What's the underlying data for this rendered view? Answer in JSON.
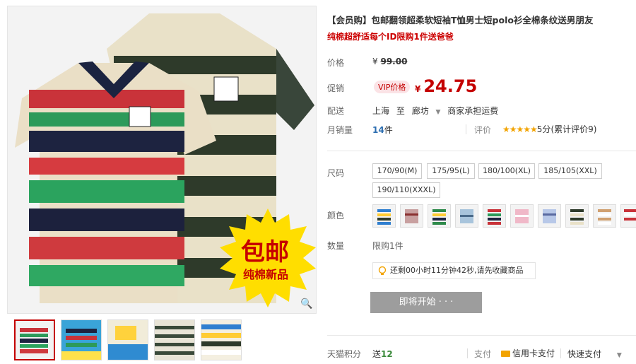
{
  "product": {
    "title": "【会员购】包邮翻领超柔软短袖T恤男士短polo衫全棉条纹送男朋友",
    "subtitle": "纯棉超舒适每个ID限购1件送爸爸"
  },
  "badge": {
    "line1": "包邮",
    "line2": "纯棉新品"
  },
  "price": {
    "label": "价格",
    "currency": "¥",
    "original": "99.00",
    "promo_label": "促销",
    "vip_tag": "VIP价格",
    "promo_price": "24.75"
  },
  "shipping": {
    "label": "配送",
    "from": "上海",
    "to_word": "至",
    "destination": "廊坊",
    "fee_note": "商家承担运费"
  },
  "sales": {
    "label": "月销量",
    "count": "14",
    "unit": "件",
    "review_label": "评价",
    "stars": "★★★★★",
    "score": "5分",
    "review_count": "(累计评价9)"
  },
  "sizes": {
    "label": "尺码",
    "options": [
      "170/90(M)",
      "175/95(L)",
      "180/100(XL)",
      "185/105(XXL)",
      "190/110(XXXL)"
    ]
  },
  "colors": {
    "label": "颜色"
  },
  "quantity": {
    "label": "数量",
    "limit_note": "限购1件"
  },
  "countdown": {
    "text": "还剩00小时11分钟42秒,请先收藏商品"
  },
  "buy_button": {
    "label": "即将开始 · · ·"
  },
  "footer": {
    "points_label": "天猫积分",
    "points_prefix": "送",
    "points_value": "12",
    "pay_label": "支付",
    "pay_method": "信用卡支付",
    "quick_pay": "快速支付"
  },
  "colors_palette": {
    "accent": "#c40000",
    "star": "#f2a300",
    "link": "#2b6db0"
  }
}
